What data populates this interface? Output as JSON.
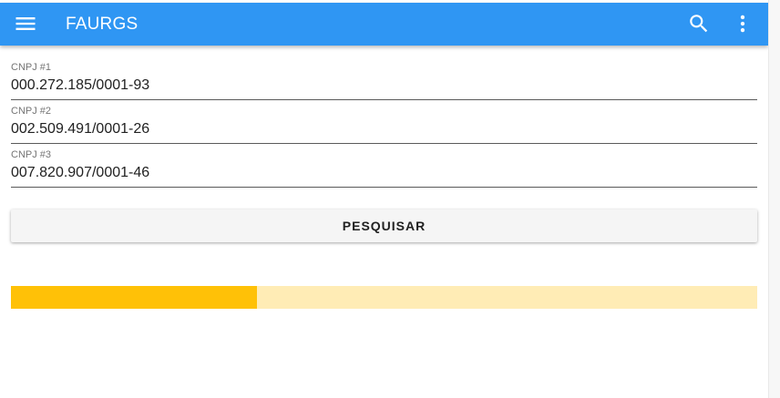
{
  "appbar": {
    "title": "FAURGS",
    "color": "#2f96f3",
    "menu_icon": "menu-icon",
    "search_icon": "search-icon",
    "more_icon": "more-vert-icon"
  },
  "fields": [
    {
      "label": "CNPJ #1",
      "value": "000.272.185/0001-93"
    },
    {
      "label": "CNPJ #2",
      "value": "002.509.491/0001-26"
    },
    {
      "label": "CNPJ #3",
      "value": "007.820.907/0001-46"
    }
  ],
  "search_button": {
    "label": "PESQUISAR"
  },
  "progress": {
    "fraction": 0.33,
    "fill_color": "#ffc107",
    "track_color": "#ffecb5"
  }
}
